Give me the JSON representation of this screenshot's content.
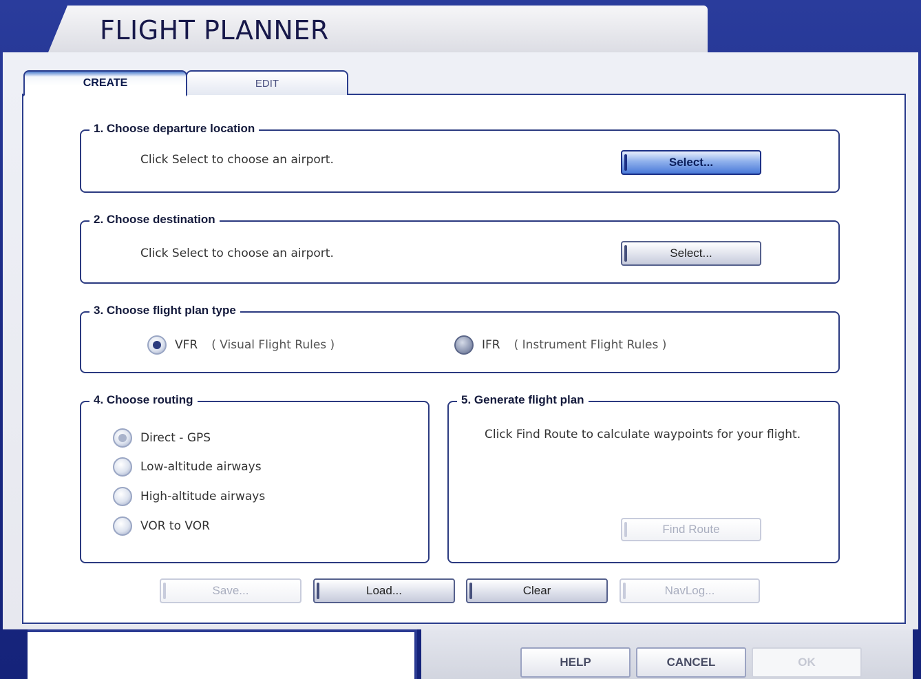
{
  "window": {
    "title": "FLIGHT PLANNER"
  },
  "tabs": [
    {
      "label": "CREATE",
      "active": true
    },
    {
      "label": "EDIT",
      "active": false
    }
  ],
  "departure": {
    "title": "1. Choose departure location",
    "hint": "Click Select to choose an airport.",
    "select_label": "Select..."
  },
  "destination": {
    "title": "2. Choose destination",
    "hint": "Click Select to choose an airport.",
    "select_label": "Select..."
  },
  "plan_type": {
    "title": "3. Choose flight plan type",
    "options": [
      {
        "label": "VFR",
        "description": "( Visual Flight Rules )",
        "checked": true
      },
      {
        "label": "IFR",
        "description": "( Instrument Flight Rules )",
        "checked": false
      }
    ]
  },
  "routing": {
    "title": "4. Choose routing",
    "options": [
      {
        "label": "Direct - GPS",
        "checked": true
      },
      {
        "label": "Low-altitude airways",
        "checked": false
      },
      {
        "label": "High-altitude airways",
        "checked": false
      },
      {
        "label": "VOR to VOR",
        "checked": false
      }
    ]
  },
  "generate": {
    "title": "5. Generate flight plan",
    "hint": "Click Find Route to calculate waypoints for your flight.",
    "find_route_label": "Find Route"
  },
  "actions": {
    "save_label": "Save...",
    "load_label": "Load...",
    "clear_label": "Clear",
    "navlog_label": "NavLog..."
  },
  "footer": {
    "help_label": "HELP",
    "cancel_label": "CANCEL",
    "ok_label": "OK"
  },
  "colors": {
    "frame_blue": "#1c2b86",
    "accent_blue": "#4a7ad9",
    "border_navy": "#2b3a80"
  }
}
